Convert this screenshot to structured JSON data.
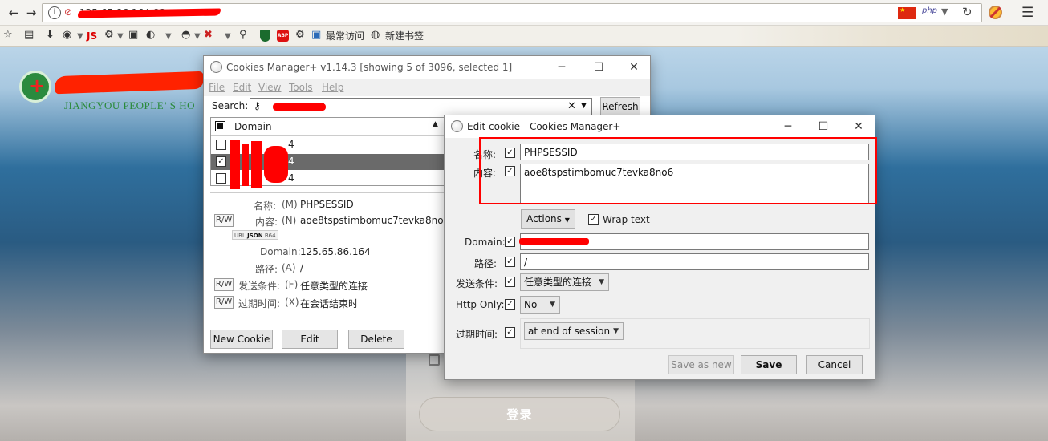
{
  "browser": {
    "url": "125.65.86.164:88",
    "search_engine_label": "php",
    "bookmarks": {
      "js_label": "JS",
      "frequent": "最常访问",
      "new_bookmark": "新建书签"
    }
  },
  "page": {
    "site_subtitle": "JIANGYOU PEOPLE’ S HO",
    "login_button": "登录"
  },
  "cookies_manager": {
    "title": "Cookies Manager+ v1.14.3 [showing 5 of 3096, selected 1]",
    "menu": [
      "File",
      "Edit",
      "View",
      "Tools",
      "Help"
    ],
    "search_label": "Search:",
    "search_value": "4",
    "refresh_label": "Refresh",
    "column_header": "Domain",
    "rows": [
      "4",
      "4",
      "4"
    ],
    "details": {
      "name_label": "名称:",
      "name_key": "(M)",
      "name_value": "PHPSESSID",
      "content_label": "内容:",
      "content_key": "(N)",
      "content_value": "aoe8tspstimbomuc7tevka8no6",
      "formats": [
        "URL",
        "JSON",
        "B64"
      ],
      "domain_label": "Domain:",
      "domain_value": "125.65.86.164",
      "path_label": "路径:",
      "path_key": "(A)",
      "path_value": "/",
      "send_label": "发送条件:",
      "send_key": "(F)",
      "send_value": "任意类型的连接",
      "expire_label": "过期时间:",
      "expire_key": "(X)",
      "expire_value": "在会话结束时",
      "rw": "R/W"
    },
    "buttons": {
      "new_cookie": "New Cookie",
      "edit": "Edit",
      "delete": "Delete"
    }
  },
  "edit_cookie": {
    "title": "Edit cookie - Cookies Manager+",
    "name_label": "名称:",
    "name_value": "PHPSESSID",
    "content_label": "内容:",
    "content_value": "aoe8tspstimbomuc7tevka8no6",
    "actions_label": "Actions",
    "wrap_label": "Wrap text",
    "domain_label": "Domain:",
    "path_label": "路径:",
    "path_value": "/",
    "send_label": "发送条件:",
    "send_value": "任意类型的连接",
    "httponly_label": "Http Only:",
    "httponly_value": "No",
    "expire_label": "过期时间:",
    "expire_value": "at end of session",
    "save_as_new": "Save as new",
    "save": "Save",
    "cancel": "Cancel"
  },
  "colors": {
    "highlight_red": "#ff0000",
    "selected_row": "#6a6a6a"
  }
}
